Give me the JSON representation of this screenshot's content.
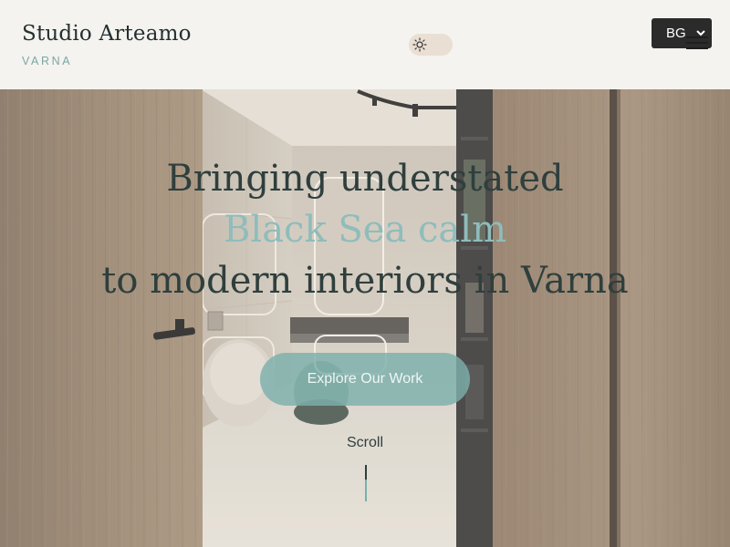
{
  "brand": {
    "name": "Studio Arteamo",
    "city": "VARNA"
  },
  "header": {
    "language": "BG",
    "theme_icon": "sun-icon",
    "menu_icon": "hamburger-menu-icon"
  },
  "hero": {
    "headline_line1": "Bringing understated",
    "headline_line2": "Black Sea calm",
    "headline_line3": "to modern interiors in Varna",
    "cta_label": "Explore Our Work",
    "scroll_label": "Scroll"
  },
  "colors": {
    "accent": "#7ab0ac",
    "text_dark": "#2f3f3d",
    "header_bg": "#f7f5f2"
  }
}
